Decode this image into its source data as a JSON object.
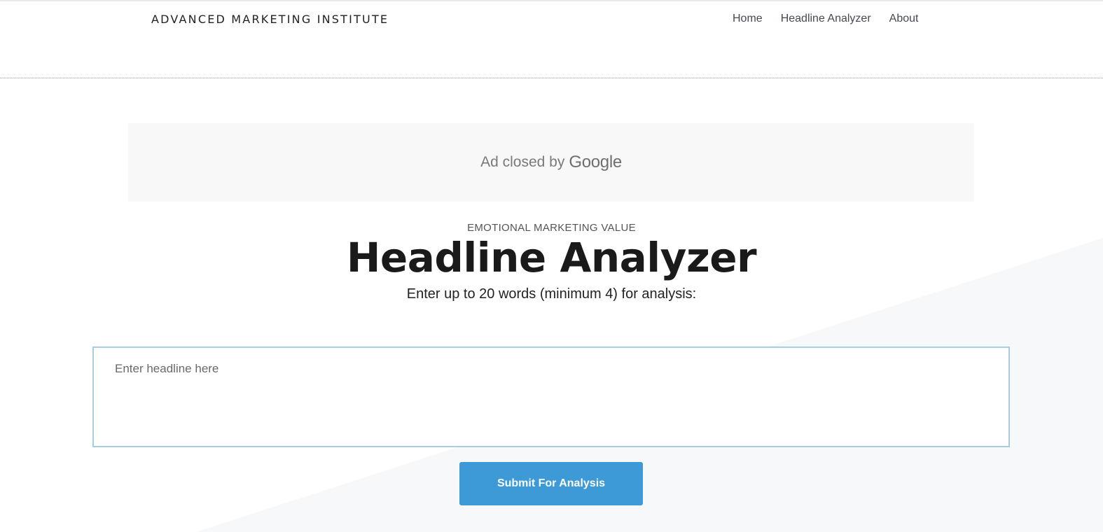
{
  "header": {
    "brand": "ADVANCED MARKETING INSTITUTE",
    "nav": [
      {
        "label": "Home"
      },
      {
        "label": "Headline Analyzer"
      },
      {
        "label": "About"
      }
    ]
  },
  "ad": {
    "text": "Ad closed by",
    "brand": "Google"
  },
  "hero": {
    "eyebrow": "EMOTIONAL MARKETING VALUE",
    "title": "Headline Analyzer",
    "subtitle": "Enter up to 20 words (minimum 4) for analysis:"
  },
  "form": {
    "placeholder": "Enter headline here",
    "value": "",
    "submit_label": "Submit For Analysis"
  },
  "colors": {
    "accent": "#3d9ad6",
    "input_border": "#a6cde0",
    "background_shape": "#f6f8fa"
  }
}
